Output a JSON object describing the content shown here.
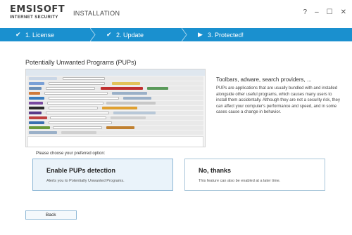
{
  "window": {
    "logo_main": "EMSISOFT",
    "logo_sub": "INTERNET SECURITY",
    "title": "INSTALLATION",
    "controls": {
      "help": "?",
      "minimize": "–",
      "maximize": "☐",
      "close": "✕"
    }
  },
  "steps": [
    {
      "label": "1. License",
      "icon": "check-icon",
      "glyph": "✔"
    },
    {
      "label": "2. Update",
      "icon": "check-icon",
      "glyph": "✔"
    },
    {
      "label": "3. Protected!",
      "icon": "arrow-icon",
      "glyph": "▶"
    }
  ],
  "section": {
    "heading": "Potentially Unwanted Programs (PUPs)",
    "info_heading": "Toolbars, adware, search providers, ...",
    "info_body": "PUPs are applications that are usually bundled with and installed alongside other useful programs, which causes many users to install them accidentally. Although they are not a security risk, they can affect your computer's performance and speed, and in some cases cause a change in behavior."
  },
  "prompt": "Please choose your preferred option:",
  "options": [
    {
      "title": "Enable PUPs detection",
      "desc": "Alerts you to Potentially Unwanted Programs.",
      "selected": true
    },
    {
      "title": "No, thanks",
      "desc": "This feature can also be enabled at a later time.",
      "selected": false
    }
  ],
  "buttons": {
    "back": "Back"
  },
  "colors": {
    "accent": "#1a90cf",
    "selected_bg": "#eaf3fa",
    "border": "#a9c6da"
  }
}
